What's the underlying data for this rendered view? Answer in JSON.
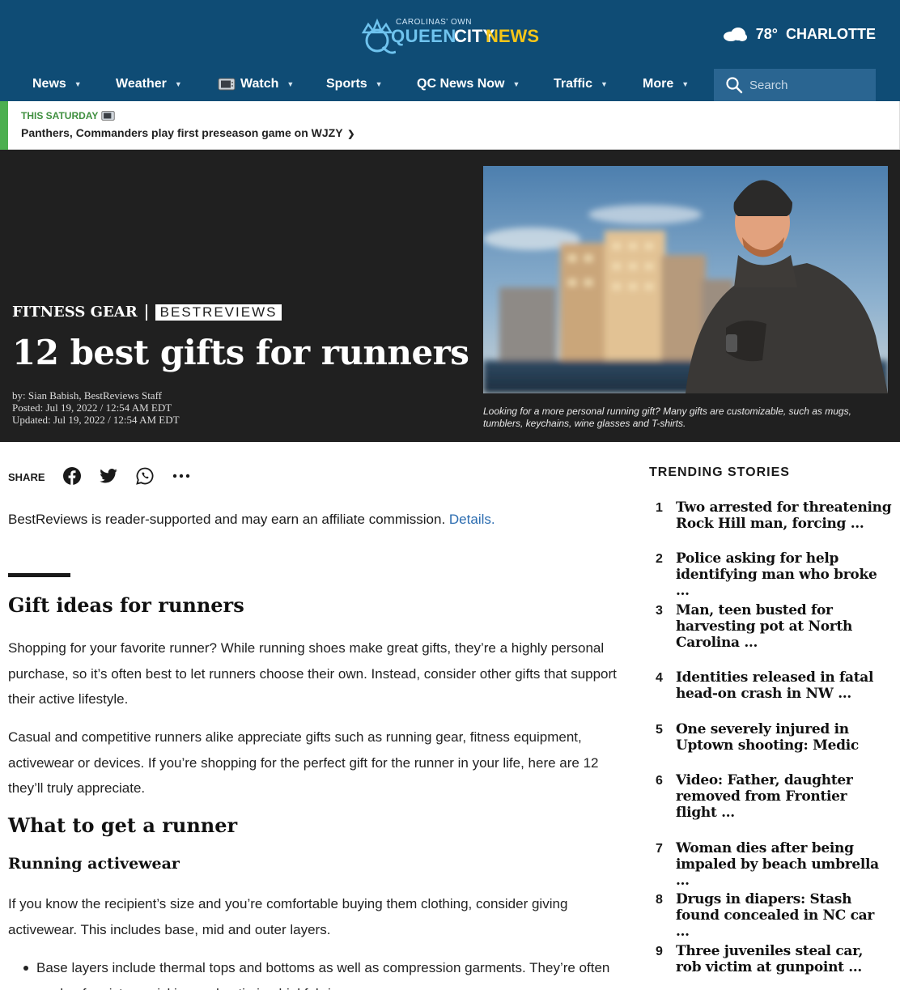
{
  "brand": {
    "tagline": "CAROLINAS' OWN",
    "name_part1": "QUEEN",
    "name_part2": "CITY",
    "name_part3": "NEWS"
  },
  "weather": {
    "temp": "78°",
    "city": "CHARLOTTE",
    "icon": "cloudy-icon"
  },
  "nav": {
    "items": [
      {
        "label": "News"
      },
      {
        "label": "Weather"
      },
      {
        "label": "Watch"
      },
      {
        "label": "Sports"
      },
      {
        "label": "QC News Now"
      },
      {
        "label": "Traffic"
      },
      {
        "label": "More"
      }
    ],
    "search_placeholder": "Search"
  },
  "alert": {
    "kicker": "THIS SATURDAY",
    "headline": "Panthers, Commanders play first preseason game on WJZY"
  },
  "hero": {
    "section": "FITNESS GEAR",
    "partner": "BESTREVIEWS",
    "title": "12 best gifts for runners",
    "byline": "by: Sian Babish, BestReviews Staff",
    "posted": "Posted: Jul 19, 2022 / 12:54 AM EDT",
    "updated": "Updated: Jul 19, 2022 / 12:54 AM EDT",
    "caption": "Looking for a more personal running gift? Many gifts are customizable, such as mugs, tumblers, keychains, wine glasses and T-shirts."
  },
  "share": {
    "label": "SHARE"
  },
  "article": {
    "disclosure": "BestReviews is reader-supported and may earn an affiliate commission.",
    "disclosure_link": "Details.",
    "heading1": "Gift ideas for runners",
    "para1": "Shopping for your favorite runner? While running shoes make great gifts, they’re a highly personal purchase, so it’s often best to let runners choose their own. Instead, consider other gifts that support their active lifestyle.",
    "para2": "Casual and competitive runners alike appreciate gifts such as running gear, fitness equipment, activewear or devices. If you’re shopping for the perfect gift for the runner in your life, here are 12 they’ll truly appreciate.",
    "heading2": "What to get a runner",
    "heading3": "Running activewear",
    "para3": "If you know the recipient’s size and you’re comfortable buying them clothing, consider giving activewear. This includes base, mid and outer layers.",
    "bullet1": "Base layers include thermal tops and bottoms as well as compression garments. They’re often made of moisture-wicking and antimicrobial fabrics."
  },
  "trending": {
    "title": "TRENDING STORIES",
    "items": [
      {
        "num": "1",
        "text": "Two arrested for threatening Rock Hill man, forcing …"
      },
      {
        "num": "2",
        "text": "Police asking for help identifying man who broke …"
      },
      {
        "num": "3",
        "text": "Man, teen busted for harvesting pot at North Carolina …"
      },
      {
        "num": "4",
        "text": "Identities released in fatal head-on crash in NW …"
      },
      {
        "num": "5",
        "text": "One severely injured in Uptown shooting: Medic"
      },
      {
        "num": "6",
        "text": "Video: Father, daughter removed from Frontier flight …"
      },
      {
        "num": "7",
        "text": "Woman dies after being impaled by beach umbrella …"
      },
      {
        "num": "8",
        "text": "Drugs in diapers: Stash found concealed in NC car …"
      },
      {
        "num": "9",
        "text": "Three juveniles steal car, rob victim at gunpoint …"
      }
    ]
  },
  "colors": {
    "header_bg": "#0f4c75",
    "alert_accent": "#4caf50",
    "hero_bg": "#202020",
    "link": "#2b6cb0"
  }
}
